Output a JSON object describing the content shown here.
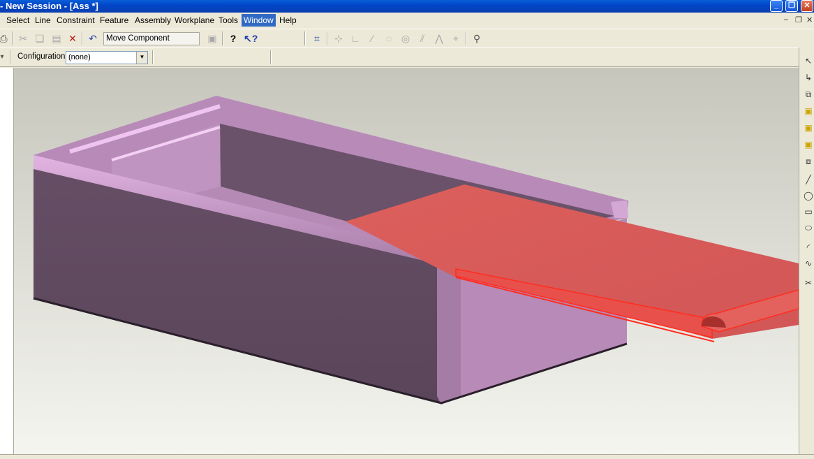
{
  "window": {
    "title": "- New Session - [Ass *]"
  },
  "menu": {
    "items": [
      {
        "label": "Select"
      },
      {
        "label": "Line"
      },
      {
        "label": "Constraint"
      },
      {
        "label": "Feature"
      },
      {
        "label": "Assembly"
      },
      {
        "label": "Workplane"
      },
      {
        "label": "Tools"
      },
      {
        "label": "Window"
      },
      {
        "label": "Help"
      }
    ],
    "active": "Window"
  },
  "toolbar": {
    "command": "Move Component"
  },
  "configuration": {
    "label": "Configuration:",
    "value": "(none)"
  },
  "icons": {
    "toolbar": [
      "print-icon",
      "cut-icon",
      "copy-icon",
      "paste-icon",
      "delete-icon",
      "undo-icon",
      "help-icon",
      "context-help-icon"
    ],
    "right": [
      "select-vertex-icon",
      "select-edge-icon",
      "select-face-icon",
      "select-body-icon",
      "select-part-icon",
      "select-component-icon",
      "line-icon",
      "circle-icon",
      "rectangle-icon",
      "ellipse-icon",
      "arc-icon",
      "spline-icon",
      "trim-icon"
    ]
  },
  "colors": {
    "box": "#bb8fbb",
    "lid": "#d85c5a",
    "viewport_top": "#c8c8be",
    "viewport_bottom": "#f4f4ef"
  }
}
